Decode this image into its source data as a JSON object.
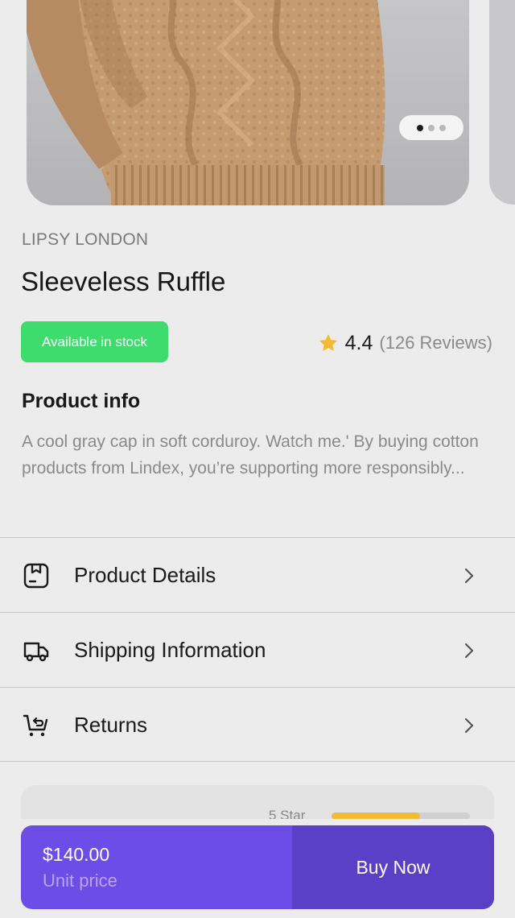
{
  "carousel": {
    "image": "knit-sweater-photo",
    "page_count": 3,
    "active_index": 0
  },
  "product": {
    "brand": "LIPSY LONDON",
    "title": "Sleeveless Ruffle",
    "stock_badge": "Available in stock",
    "rating_icon": "star-icon",
    "rating": "4.4",
    "reviews": "(126 Reviews)"
  },
  "info": {
    "heading": "Product info",
    "text": "A cool gray cap in soft corduroy. Watch me.' By buying cotton products from Lindex, you’re supporting more responsibly..."
  },
  "menu": {
    "items": [
      {
        "label": "Product Details",
        "icon": "package-box-icon"
      },
      {
        "label": "Shipping Information",
        "icon": "truck-icon"
      },
      {
        "label": "Returns",
        "icon": "return-cart-icon"
      }
    ]
  },
  "reviews_summary": {
    "star_label": "5 Star",
    "bar_fraction": 0.64
  },
  "purchase": {
    "price": "$140.00",
    "unit_label": "Unit price",
    "buy_label": "Buy Now"
  },
  "colors": {
    "accent": "#6c4ee6",
    "accent_dark": "#5a3fc7",
    "stock_green": "#3ddc6c",
    "star": "#f3bb35"
  }
}
